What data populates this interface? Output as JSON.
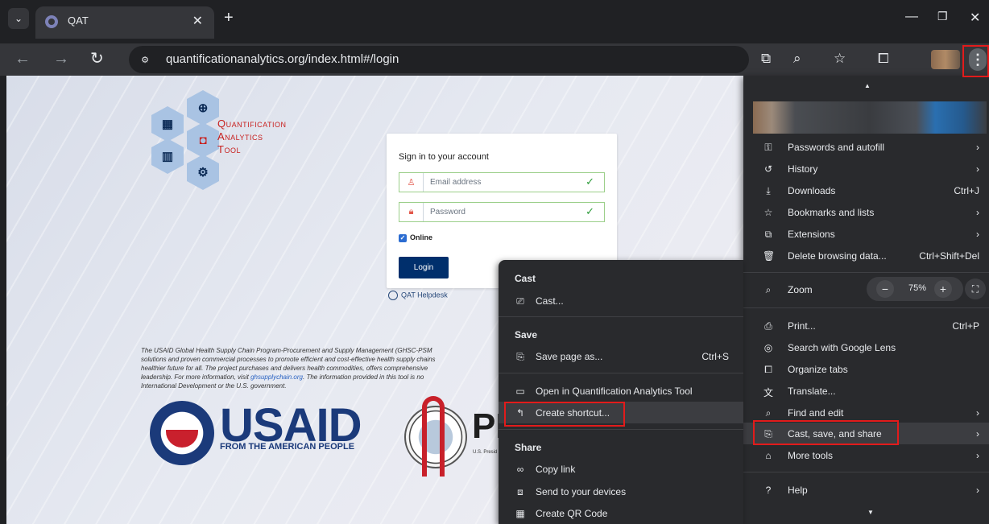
{
  "browser": {
    "tab_title": "QAT",
    "new_tab": "+",
    "url": "quantificationanalytics.org/index.html#/login"
  },
  "page": {
    "brand_line1": "Quantification",
    "brand_line2": "Analytics",
    "brand_line3": "Tool",
    "signin_heading": "Sign in to your account",
    "email_placeholder": "Email address",
    "password_placeholder": "Password",
    "online_label": "Online",
    "login_button": "Login",
    "helpdesk": "QAT Helpdesk",
    "disclaimer_1": "The USAID Global Health Supply Chain Program-Procurement and Supply Management (GHSC-PSM",
    "disclaimer_2": "solutions and proven commercial processes to promote efficient and cost-effective health supply chains",
    "disclaimer_3": "healthier future for all. The project purchases and delivers health commodities, offers comprehensive",
    "disclaimer_4a": "leadership. For more information, visit ",
    "disclaimer_link": "ghsupplychain.org",
    "disclaimer_4b": ". The information provided in this tool is no",
    "disclaimer_5": "International Development or the U.S. government.",
    "usaid_word": "USAID",
    "usaid_sub": "FROM THE AMERICAN PEOPLE",
    "pepfar_word": "PE",
    "pepfar_sub": "U.S. Presid"
  },
  "menu": {
    "items": [
      {
        "icon": "key-icon",
        "glyph": "⚿",
        "label": "Passwords and autofill",
        "right": "›"
      },
      {
        "icon": "history-icon",
        "glyph": "↺",
        "label": "History",
        "right": "›"
      },
      {
        "icon": "download-icon",
        "glyph": "⤓",
        "label": "Downloads",
        "right": "Ctrl+J"
      },
      {
        "icon": "star-icon",
        "glyph": "☆",
        "label": "Bookmarks and lists",
        "right": "›"
      },
      {
        "icon": "extension-icon",
        "glyph": "⧉",
        "label": "Extensions",
        "right": "›"
      },
      {
        "icon": "trash-icon",
        "glyph": "🗑",
        "label": "Delete browsing data...",
        "right": "Ctrl+Shift+Del"
      }
    ],
    "zoom_label": "Zoom",
    "zoom_value": "75%",
    "items2": [
      {
        "icon": "print-icon",
        "glyph": "⎙",
        "label": "Print...",
        "right": "Ctrl+P"
      },
      {
        "icon": "lens-icon",
        "glyph": "◎",
        "label": "Search with Google Lens",
        "right": ""
      },
      {
        "icon": "organize-tabs-icon",
        "glyph": "⧠",
        "label": "Organize tabs",
        "right": ""
      },
      {
        "icon": "translate-icon",
        "glyph": "文",
        "label": "Translate...",
        "right": ""
      },
      {
        "icon": "find-icon",
        "glyph": "⌕",
        "label": "Find and edit",
        "right": "›"
      },
      {
        "icon": "cast-save-share-icon",
        "glyph": "⎘",
        "label": "Cast, save, and share",
        "right": "›"
      },
      {
        "icon": "tools-icon",
        "glyph": "⌂",
        "label": "More tools",
        "right": "›"
      }
    ],
    "help": {
      "icon": "help-icon",
      "glyph": "?",
      "label": "Help",
      "right": "›"
    }
  },
  "submenu": {
    "cast_header": "Cast",
    "cast_item": "Cast...",
    "save_header": "Save",
    "save_page": "Save page as...",
    "save_shortcut": "Ctrl+S",
    "open_in": "Open in Quantification Analytics Tool",
    "create_shortcut": "Create shortcut...",
    "share_header": "Share",
    "copy_link": "Copy link",
    "send_devices": "Send to your devices",
    "qr_code": "Create QR Code"
  },
  "colors": {
    "highlight": "#e21b1b",
    "brand_red": "#c8201e",
    "usaid_blue": "#1b3a7a",
    "login_blue": "#002f6c"
  }
}
